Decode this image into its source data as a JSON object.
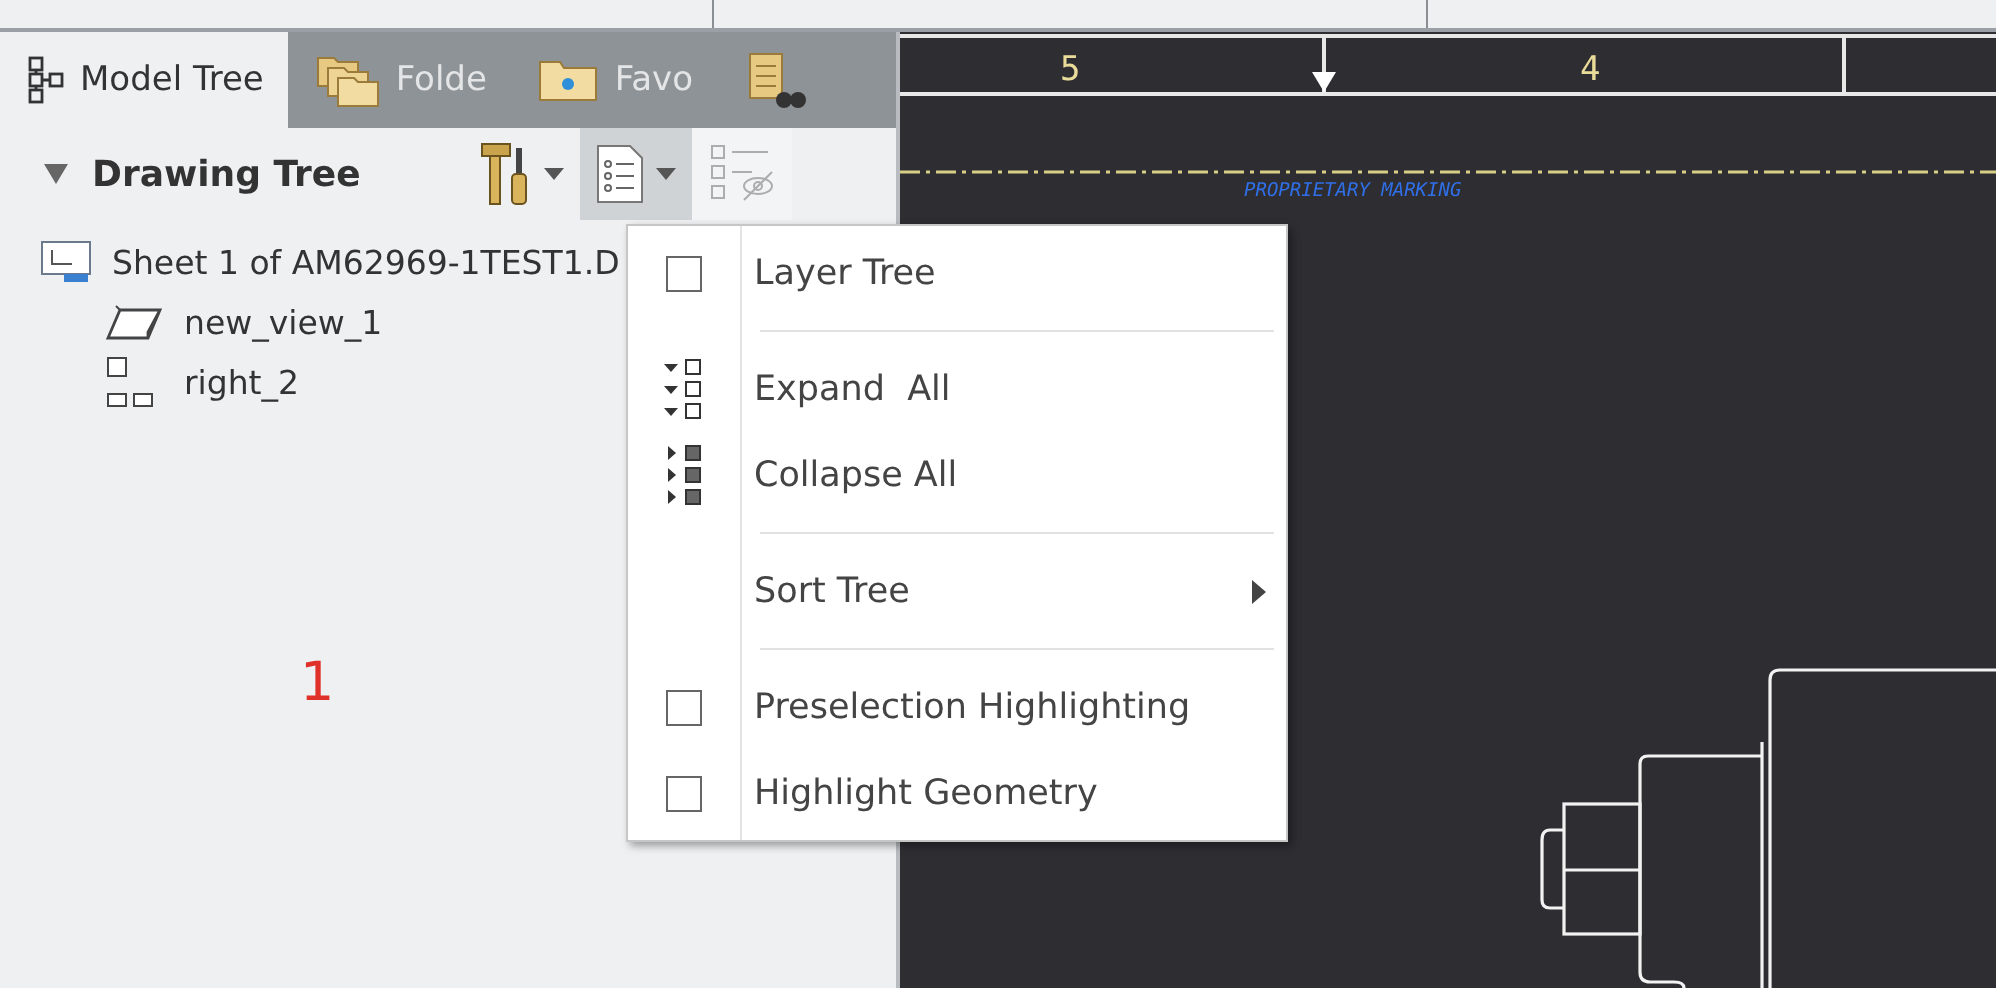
{
  "tabs": [
    {
      "label": "Model Tree",
      "selected": true,
      "kind": "tree"
    },
    {
      "label": "Folde",
      "selected": false,
      "kind": "folders"
    },
    {
      "label": "Favo",
      "selected": false,
      "kind": "favorites"
    },
    {
      "selected": false,
      "kind": "finder"
    }
  ],
  "panel": {
    "title": "Drawing Tree",
    "expanded": true
  },
  "toolbar": [
    {
      "kind": "tools",
      "dropdown": true,
      "pressed": false,
      "disabled": false
    },
    {
      "kind": "list",
      "dropdown": true,
      "pressed": true,
      "disabled": false
    },
    {
      "kind": "filter",
      "dropdown": false,
      "pressed": false,
      "disabled": true
    }
  ],
  "tree": [
    {
      "label": "Sheet 1 of AM62969-1TEST1.D",
      "kind": "sheet",
      "children": [
        {
          "label": "new_view_1",
          "kind": "solid"
        },
        {
          "label": "right_2",
          "kind": "projection"
        }
      ]
    }
  ],
  "callout": "1",
  "menu": [
    {
      "kind": "check",
      "label": "Layer Tree",
      "checked": false
    },
    {
      "kind": "separator"
    },
    {
      "kind": "expand",
      "label": "Expand  All"
    },
    {
      "kind": "collapse",
      "label": "Collapse All"
    },
    {
      "kind": "separator"
    },
    {
      "kind": "submenu",
      "label": "Sort Tree"
    },
    {
      "kind": "separator"
    },
    {
      "kind": "check",
      "label": "Preselection Highlighting",
      "checked": false
    },
    {
      "kind": "check",
      "label": "Highlight Geometry",
      "checked": false
    }
  ],
  "drawing": {
    "zones": [
      "5",
      "4"
    ],
    "marking": "PROPRIETARY MARKING"
  }
}
